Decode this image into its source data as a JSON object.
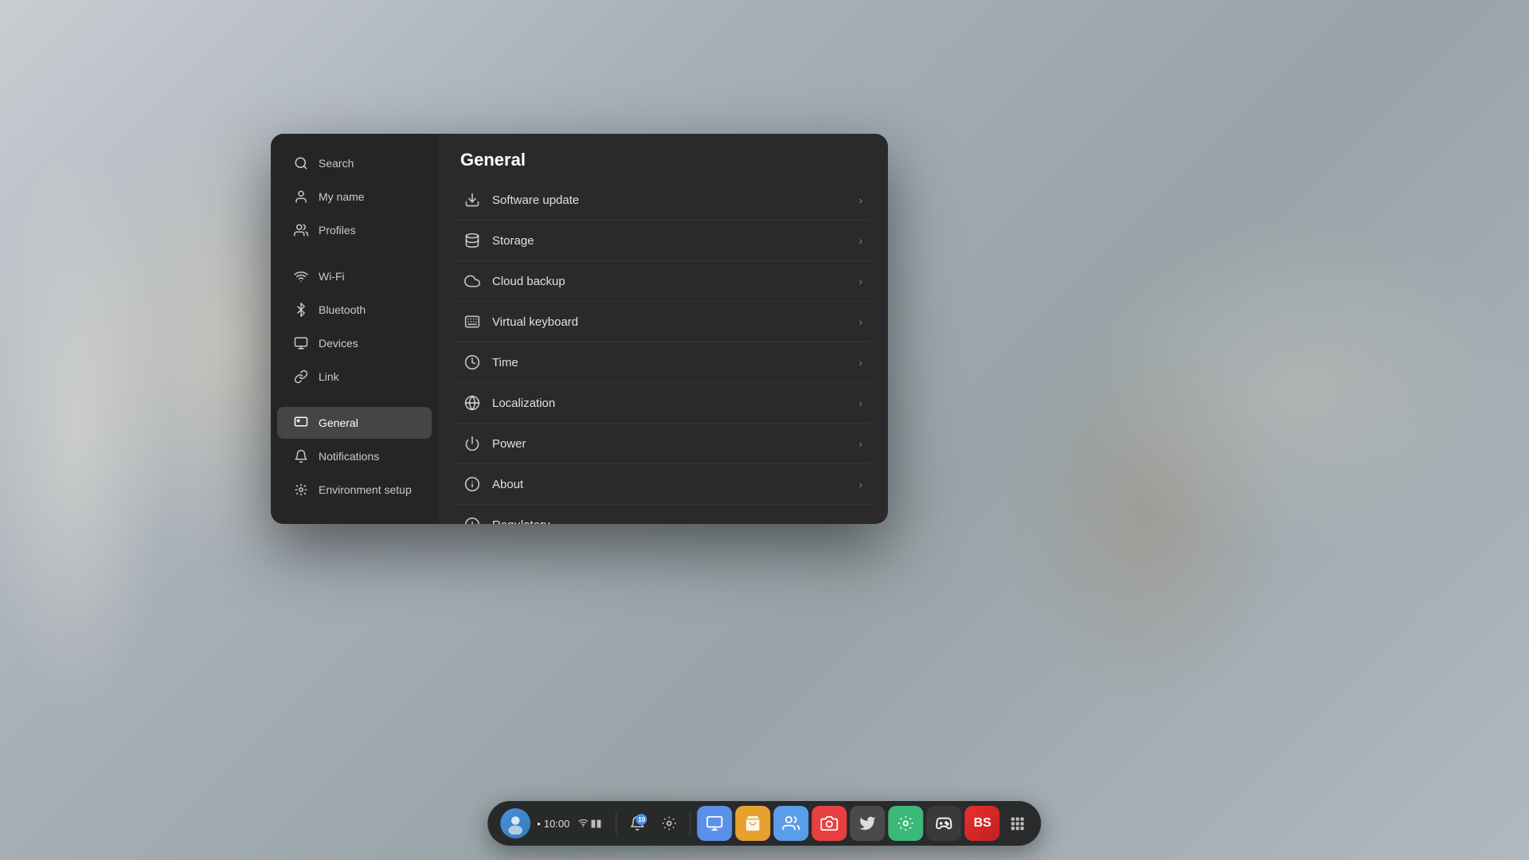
{
  "background": {
    "color": "#b0b8c0"
  },
  "settings_window": {
    "title": "General",
    "sidebar": {
      "items": [
        {
          "id": "search",
          "label": "Search",
          "icon": "🔍"
        },
        {
          "id": "my-name",
          "label": "My name",
          "icon": "👤"
        },
        {
          "id": "profiles",
          "label": "Profiles",
          "icon": "👥"
        },
        {
          "id": "wifi",
          "label": "Wi-Fi",
          "icon": "wifi"
        },
        {
          "id": "bluetooth",
          "label": "Bluetooth",
          "icon": "bluetooth"
        },
        {
          "id": "devices",
          "label": "Devices",
          "icon": "devices"
        },
        {
          "id": "link",
          "label": "Link",
          "icon": "link"
        },
        {
          "id": "general",
          "label": "General",
          "icon": "general",
          "active": true
        },
        {
          "id": "notifications",
          "label": "Notifications",
          "icon": "🔔"
        },
        {
          "id": "environment-setup",
          "label": "Environment setup",
          "icon": "⚙️"
        }
      ]
    },
    "settings_items": [
      {
        "id": "software-update",
        "label": "Software update",
        "icon": "download"
      },
      {
        "id": "storage",
        "label": "Storage",
        "icon": "storage"
      },
      {
        "id": "cloud-backup",
        "label": "Cloud backup",
        "icon": "cloud"
      },
      {
        "id": "virtual-keyboard",
        "label": "Virtual keyboard",
        "icon": "keyboard"
      },
      {
        "id": "time",
        "label": "Time",
        "icon": "clock"
      },
      {
        "id": "localization",
        "label": "Localization",
        "icon": "globe"
      },
      {
        "id": "power",
        "label": "Power",
        "icon": "power"
      },
      {
        "id": "about",
        "label": "About",
        "icon": "info"
      },
      {
        "id": "regulatory",
        "label": "Regulatory",
        "icon": "regulatory"
      }
    ]
  },
  "taskbar": {
    "time": "10:00",
    "time_prefix": "•",
    "notification_count": "10",
    "apps": [
      {
        "id": "monitor",
        "label": "Monitor",
        "class": "app-monitor",
        "icon": "🖥"
      },
      {
        "id": "store",
        "label": "Store",
        "class": "app-store",
        "icon": "🛍"
      },
      {
        "id": "people",
        "label": "People",
        "class": "app-people",
        "icon": "👥"
      },
      {
        "id": "photos",
        "label": "Photos",
        "class": "app-photo",
        "icon": "📷"
      },
      {
        "id": "twitter",
        "label": "Twitter",
        "class": "app-bird",
        "icon": "🐦"
      },
      {
        "id": "settings",
        "label": "Settings",
        "class": "app-settings",
        "icon": "⚙"
      },
      {
        "id": "game1",
        "label": "Game",
        "class": "app-game1",
        "icon": "🎮"
      },
      {
        "id": "beatsaber",
        "label": "Beat Saber",
        "class": "app-beatsaber",
        "icon": "⚔"
      },
      {
        "id": "grid",
        "label": "App Grid",
        "class": "app-grid",
        "icon": "⋯"
      }
    ]
  }
}
